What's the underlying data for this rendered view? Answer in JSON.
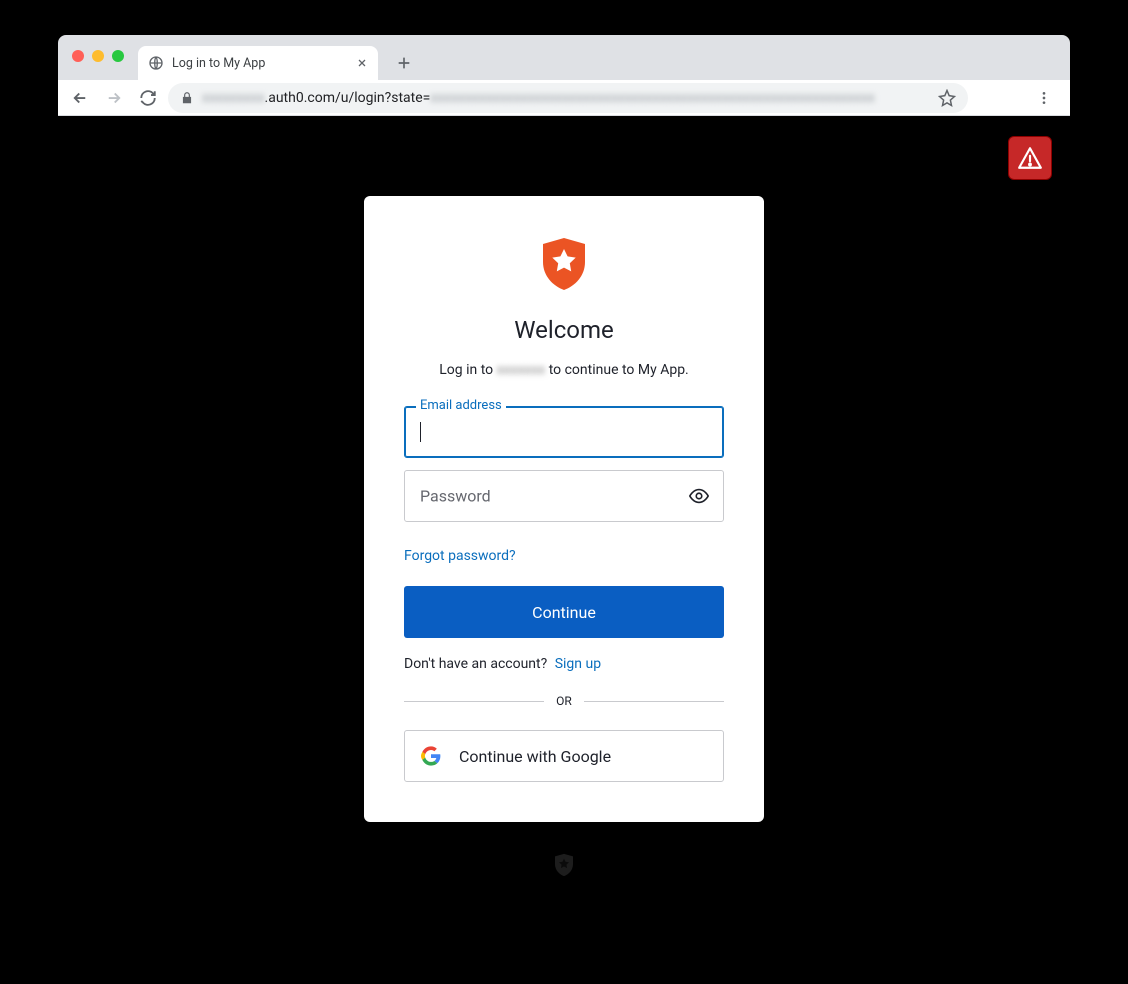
{
  "browser": {
    "tab_title": "Log in to My App",
    "url_visible_segment": ".auth0.com/u/login?state="
  },
  "alert": {
    "icon": "warning-triangle"
  },
  "login": {
    "welcome": "Welcome",
    "subtitle_prefix": "Log in to ",
    "subtitle_suffix": " to continue to My App.",
    "email_label": "Email address",
    "email_value": "",
    "password_placeholder": "Password",
    "password_value": "",
    "forgot": "Forgot password?",
    "continue": "Continue",
    "no_account": "Don't have an account?",
    "signup": "Sign up",
    "or": "OR",
    "google": "Continue with Google"
  },
  "colors": {
    "primary": "#0a5ec2",
    "link": "#0a6ebd",
    "logo": "#eb5424",
    "alert_bg": "#c62828"
  }
}
